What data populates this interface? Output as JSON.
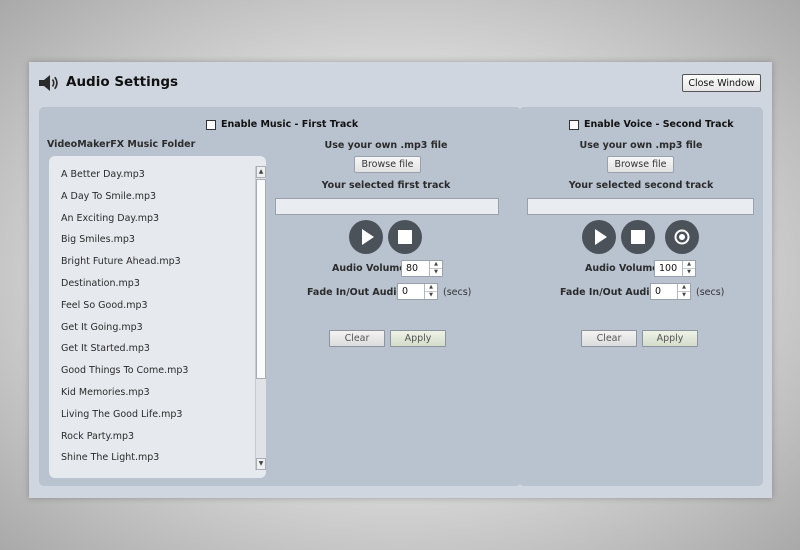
{
  "dialog": {
    "title": "Audio Settings",
    "close_label": "Close Window"
  },
  "music": {
    "enable_label": "Enable Music - First Track",
    "folder_label": "VideoMakerFX Music Folder",
    "own_file_label": "Use your own .mp3 file",
    "browse_label": "Browse file",
    "selected_label": "Your selected first track",
    "selected_value": "",
    "volume_label": "Audio Volume",
    "volume_value": "80",
    "fade_label": "Fade In/Out Audio",
    "fade_value": "0",
    "fade_unit": "(secs)",
    "clear_label": "Clear",
    "apply_label": "Apply",
    "tracks": [
      "A Better Day.mp3",
      "A Day To Smile.mp3",
      "An Exciting Day.mp3",
      "Big Smiles.mp3",
      "Bright Future Ahead.mp3",
      "Destination.mp3",
      "Feel So Good.mp3",
      "Get It Going.mp3",
      "Get It Started.mp3",
      "Good Things To Come.mp3",
      "Kid Memories.mp3",
      "Living The Good Life.mp3",
      "Rock Party.mp3",
      "Shine The Light.mp3"
    ]
  },
  "voice": {
    "enable_label": "Enable Voice - Second Track",
    "own_file_label": "Use your own .mp3 file",
    "browse_label": "Browse file",
    "selected_label": "Your selected second track",
    "selected_value": "",
    "volume_label": "Audio Volume",
    "volume_value": "100",
    "fade_label": "Fade In/Out Audio",
    "fade_value": "0",
    "fade_unit": "(secs)",
    "clear_label": "Clear",
    "apply_label": "Apply"
  },
  "icons": {
    "speaker": "speaker-icon",
    "play": "play-icon",
    "stop": "stop-icon",
    "record": "record-icon"
  },
  "colors": {
    "dialog_bg": "#cfd6df",
    "panel_bg": "#b9c2cf",
    "control_bg": "#4c525a"
  }
}
